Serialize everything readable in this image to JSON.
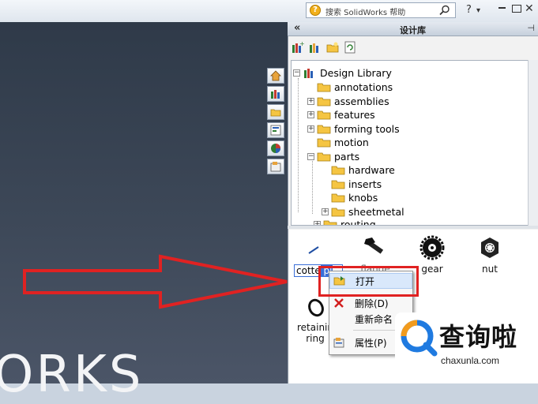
{
  "topbar": {
    "search_placeholder": "搜索 SolidWorks 帮助",
    "help_glyph": "?",
    "dropdown_glyph": "▾"
  },
  "panel": {
    "collapse_glyph": "«",
    "title": "设计库",
    "pin_glyph": "⊣"
  },
  "tree": {
    "root": "Design Library",
    "items": [
      {
        "label": "annotations",
        "expander": ""
      },
      {
        "label": "assemblies",
        "expander": "+"
      },
      {
        "label": "features",
        "expander": "+"
      },
      {
        "label": "forming tools",
        "expander": "+"
      },
      {
        "label": "motion",
        "expander": ""
      },
      {
        "label": "parts",
        "expander": "−"
      }
    ],
    "parts_children": [
      {
        "label": "hardware",
        "expander": ""
      },
      {
        "label": "inserts",
        "expander": ""
      },
      {
        "label": "knobs",
        "expander": ""
      },
      {
        "label": "sheetmetal",
        "expander": "+"
      }
    ],
    "clipped_item": "routing"
  },
  "items": {
    "edit_text": "cotte",
    "edit_selected": " pi",
    "hidden_label": "flange nut",
    "gear": "gear",
    "nut": "nut",
    "retaining_line1": "retainin",
    "retaining_line2": "ring"
  },
  "context_menu": {
    "open": "打开",
    "delete": "删除(D)",
    "rename": "重新命名",
    "properties": "属性(P)"
  },
  "watermark": "ORKS",
  "brand": {
    "chinese": "查询啦",
    "url": "chaxunla.com"
  },
  "colors": {
    "highlight": "#e02222",
    "selection": "#3a6fd8",
    "graphics_bg": "#3d4858",
    "folder": "#f5c542"
  }
}
